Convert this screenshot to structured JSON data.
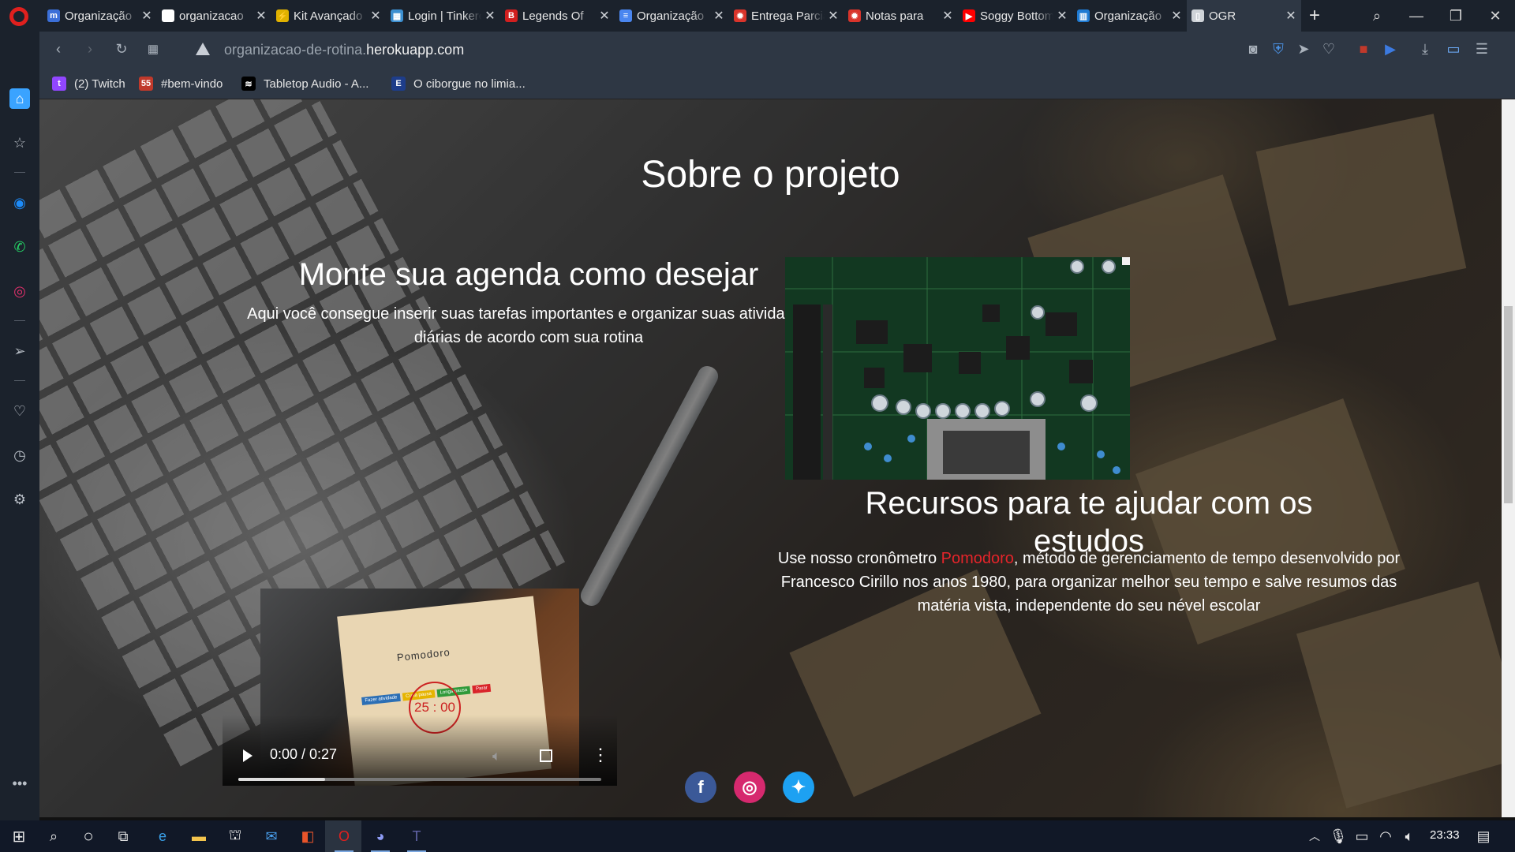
{
  "browser": {
    "tabs": [
      {
        "title": "Organização",
        "icon": "m-icon",
        "color": "#3b6fd8",
        "glyph": "m"
      },
      {
        "title": "organizacao",
        "icon": "github-icon",
        "color": "#ffffff",
        "glyph": "●"
      },
      {
        "title": "Kit Avançado",
        "icon": "lightning-icon",
        "color": "#e0b100",
        "glyph": "⚡"
      },
      {
        "title": "Login | Tinkercad",
        "icon": "tinkercad-icon",
        "color": "#3c8fd0",
        "glyph": "▦"
      },
      {
        "title": "Legends Of",
        "icon": "bold-b-icon",
        "color": "#d21f1f",
        "glyph": "B"
      },
      {
        "title": "Organização",
        "icon": "docs-icon",
        "color": "#4a86f0",
        "glyph": "≡"
      },
      {
        "title": "Entrega Parcial",
        "icon": "gear-red-icon",
        "color": "#d9342b",
        "glyph": "✹"
      },
      {
        "title": "Notas para",
        "icon": "gear-red-icon",
        "color": "#d9342b",
        "glyph": "✹"
      },
      {
        "title": "Soggy Bottom",
        "icon": "youtube-icon",
        "color": "#ff0000",
        "glyph": "▶"
      },
      {
        "title": "Organização",
        "icon": "trello-icon",
        "color": "#1f7bd3",
        "glyph": "▥"
      },
      {
        "title": "OGR",
        "icon": "file-icon",
        "color": "#cfd3d8",
        "glyph": "▯"
      }
    ],
    "active_tab_index": 10,
    "url_prefix": "organizacao-de-rotina.",
    "url_domain": "herokuapp.com",
    "bookmarks": [
      {
        "label": "(2) Twitch",
        "icon": "twitch-icon",
        "color": "#9146ff",
        "glyph": "t"
      },
      {
        "label": "#bem-vindo",
        "icon": "discord-server-icon",
        "color": "#c0392b",
        "glyph": "55"
      },
      {
        "label": "Tabletop Audio - A...",
        "icon": "tabletop-audio-icon",
        "color": "#000000",
        "glyph": "≋"
      },
      {
        "label": "O ciborgue no limia...",
        "icon": "e-letter-icon",
        "color": "#1e3d8a",
        "glyph": "E"
      }
    ]
  },
  "page": {
    "section_title": "Sobre o projeto",
    "block1": {
      "heading": "Monte sua agenda como desejar",
      "text": "Aqui você consegue inserir suas tarefas importantes e organizar suas atividades diárias de acordo com sua rotina"
    },
    "block2": {
      "heading_line1": "Recursos para te ajudar com os",
      "heading_line2": "estudos",
      "text_before": "Use nosso cronômetro ",
      "link": "Pomodoro",
      "text_after": ", método de gerenciamento de tempo desenvolvido por Francesco Cirillo nos anos 1980, para organizar melhor seu tempo e salve resumos das matéria vista, independente do seu nével escolar"
    },
    "video": {
      "card_title": "Pomodoro",
      "timer": "25 : 00",
      "buttons": [
        "Fazer atividade",
        "Curta pausa",
        "Longa pausa",
        "Parar"
      ],
      "button_colors": [
        "#2c6fb5",
        "#e6b400",
        "#2f9a3a",
        "#d9242a"
      ],
      "time": "0:00 / 0:27",
      "progress": 0.24
    },
    "social": [
      {
        "name": "facebook",
        "icon": "facebook-icon",
        "color": "#3b5998",
        "glyph": "f"
      },
      {
        "name": "instagram",
        "icon": "instagram-icon",
        "color": "#d6296e",
        "glyph": "◎"
      },
      {
        "name": "twitter",
        "icon": "twitter-icon",
        "color": "#1da1f2",
        "glyph": "✦"
      }
    ]
  },
  "taskbar": {
    "clock": "23:33"
  }
}
